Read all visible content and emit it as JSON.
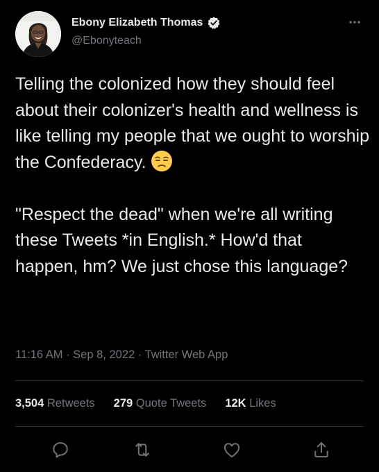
{
  "author": {
    "display_name": "Ebony Elizabeth Thomas",
    "handle": "@Ebonyteach",
    "verified": true
  },
  "tweet": {
    "paragraphs": [
      "Telling the colonized how they should feel about their colonizer's health and wellness is like telling my people that we ought to worship the Confederacy.",
      "\"Respect the dead\" when we're all writing these Tweets *in English.* How'd that happen, hm? We just chose this language?"
    ],
    "emoji": "unamused-face"
  },
  "meta": {
    "time": "11:16 AM",
    "separator1": " · ",
    "date": "Sep 8, 2022",
    "separator2": " · ",
    "source": "Twitter Web App"
  },
  "stats": {
    "retweets": {
      "count": "3,504",
      "label": "Retweets"
    },
    "quote_tweets": {
      "count": "279",
      "label": "Quote Tweets"
    },
    "likes": {
      "count": "12K",
      "label": "Likes"
    }
  },
  "icons": {
    "verified": "verified-badge-icon",
    "more": "more-icon",
    "reply": "reply-icon",
    "retweet": "retweet-icon",
    "like": "like-icon",
    "share": "share-icon"
  },
  "colors": {
    "background": "#000000",
    "text": "#e7e9ea",
    "muted": "#71767b",
    "divider": "#2f3336",
    "emoji": "#ffcc4d"
  }
}
